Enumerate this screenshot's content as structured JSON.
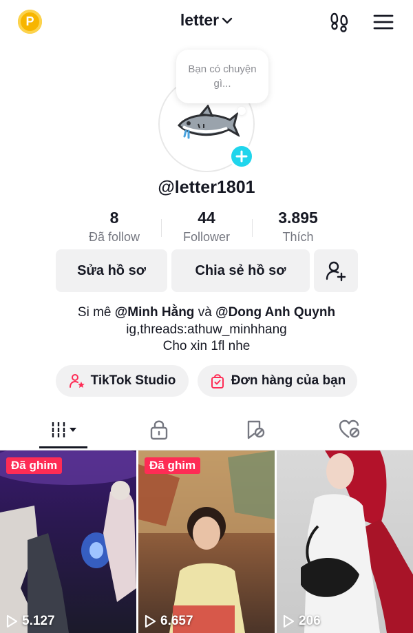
{
  "header": {
    "coin_letter": "P",
    "title": "letter",
    "icons": [
      "coin-icon",
      "chevron-down-icon",
      "footprints-icon",
      "menu-icon"
    ]
  },
  "profile": {
    "bubble_text": "Bạn có chuyện gì...",
    "username": "@letter1801",
    "stats": [
      {
        "value": "8",
        "label": "Đã follow"
      },
      {
        "value": "44",
        "label": "Follower"
      },
      {
        "value": "3.895",
        "label": "Thích"
      }
    ],
    "buttons": {
      "edit": "Sửa hồ sơ",
      "share": "Chia sẻ hồ sơ"
    },
    "bio": {
      "line1_prefix": "Si mê",
      "mention1": "@Minh Hằng",
      "line1_middle": "và",
      "mention2": "@Dong Anh Quynh",
      "line2": "ig,threads:athuw_minhhang",
      "line3": "Cho xin 1fl nhe"
    },
    "pills": {
      "studio": "TikTok Studio",
      "orders": "Đơn hàng của bạn"
    }
  },
  "tabs": [
    "videos-grid-icon",
    "lock-icon",
    "tagged-icon",
    "liked-icon"
  ],
  "videos": [
    {
      "pinned_label": "Đã ghim",
      "views": "5.127"
    },
    {
      "pinned_label": "Đã ghim",
      "views": "6.657"
    },
    {
      "pinned_label": "",
      "views": "206"
    }
  ],
  "colors": {
    "accent": "#fe2c55",
    "add_button": "#20d5ec",
    "coin": "#f7b500",
    "button_bg": "#f1f1f2"
  }
}
